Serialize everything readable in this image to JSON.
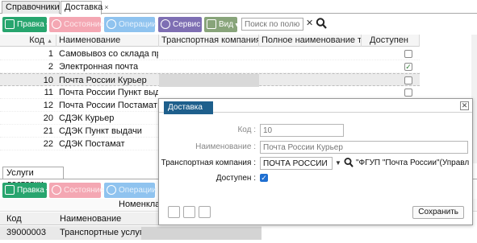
{
  "top_tabs": [
    {
      "label": "Справочники"
    },
    {
      "label": "Доставка",
      "close": "×"
    }
  ],
  "toolbar": {
    "edit": "Правка",
    "state": "Состояние",
    "operations": "Операции",
    "service": "Сервис",
    "view": "Вид",
    "search_placeholder": "Поиск по полю",
    "clear": "✕"
  },
  "grid": {
    "headers": [
      "Код",
      "Наименование",
      "Транспортная компания",
      "Полное наименование тр...",
      "Доступен"
    ],
    "sort_arrow": "▲",
    "rows": [
      {
        "code": "1",
        "name": "Самовывоз со склада про...",
        "transport": "",
        "full": "",
        "available": false
      },
      {
        "code": "2",
        "name": "Электронная почта",
        "transport": "",
        "full": "",
        "available": true
      },
      {
        "code": "10",
        "name": "Почта России Курьер",
        "transport": "",
        "full": "",
        "available": false
      },
      {
        "code": "11",
        "name": "Почта России Пункт выдачи",
        "transport": "",
        "full": "",
        "available": false
      },
      {
        "code": "12",
        "name": "Почта России Постамат",
        "transport": "",
        "full": "",
        "available": false
      },
      {
        "code": "20",
        "name": "СДЭК Курьер",
        "transport": "",
        "full": "",
        "available": false
      },
      {
        "code": "21",
        "name": "СДЭК Пункт выдачи",
        "transport": "",
        "full": "",
        "available": false
      },
      {
        "code": "22",
        "name": "СДЭК Постамат",
        "transport": "",
        "full": "",
        "available": false
      }
    ],
    "check_mark": "✓"
  },
  "bottom": {
    "tab": "Услуги доставки",
    "toolbar": {
      "edit": "Правка",
      "state": "Состояние",
      "operations": "Операции"
    },
    "group_header": "Номенклатура",
    "headers": [
      "Код",
      "Наименование"
    ],
    "rows": [
      {
        "code": "39000003",
        "name": "Транспортные услуги"
      }
    ]
  },
  "dialog": {
    "title": "Доставка",
    "close": "✕",
    "fields": {
      "code_label": "Код :",
      "code_value": "10",
      "name_label": "Наименование :",
      "name_value": "Почта России Курьер",
      "transport_label": "Транспортная компания :",
      "transport_value": "ПОЧТА РОССИИ",
      "transport_full": "\"ФГУП \"Почта России\"(Управлен...",
      "available_label": "Доступен :",
      "available_check": "✓"
    },
    "save": "Сохранить"
  },
  "colors": {
    "edit_green": "#27a56e",
    "state_pink": "#f4a7b3",
    "operations_blue": "#8fc3ef",
    "service_purple": "#7e6fb3",
    "view_olive": "#88a47a",
    "dialog_title_bg": "#1e5f8c",
    "checkbox_blue": "#1f6fd1"
  },
  "icons": {
    "edit": "pencil-icon",
    "state": "status-circle-icon",
    "operations": "refresh-icon",
    "service": "gear-icon",
    "view": "grid-icon",
    "search": "search-icon",
    "close": "close-icon"
  }
}
